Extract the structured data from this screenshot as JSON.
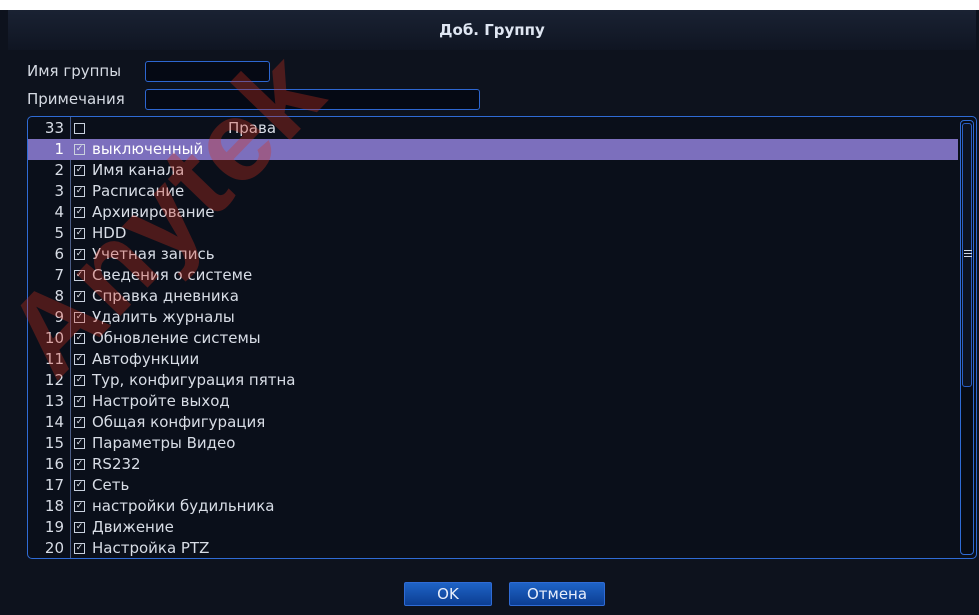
{
  "dialog": {
    "title": "Доб. Группу",
    "group_name_label": "Имя группы",
    "group_name_value": "",
    "notes_label": "Примечания",
    "notes_value": ""
  },
  "rights_list": {
    "count": "33",
    "header_label": "Права",
    "header_checked": false,
    "selected_index": 0,
    "rows": [
      {
        "num": "1",
        "label": "выключенный",
        "checked": true
      },
      {
        "num": "2",
        "label": "Имя канала",
        "checked": true
      },
      {
        "num": "3",
        "label": "Расписание",
        "checked": true
      },
      {
        "num": "4",
        "label": "Архивирование",
        "checked": true
      },
      {
        "num": "5",
        "label": "HDD",
        "checked": true
      },
      {
        "num": "6",
        "label": "Учетная запись",
        "checked": true
      },
      {
        "num": "7",
        "label": "Сведения о системе",
        "checked": true
      },
      {
        "num": "8",
        "label": "Справка дневника",
        "checked": true
      },
      {
        "num": "9",
        "label": "Удалить журналы",
        "checked": true
      },
      {
        "num": "10",
        "label": "Обновление системы",
        "checked": true
      },
      {
        "num": "11",
        "label": "Автофункции",
        "checked": true
      },
      {
        "num": "12",
        "label": "Тур, конфигурация пятна",
        "checked": true
      },
      {
        "num": "13",
        "label": "Настройте выход",
        "checked": true
      },
      {
        "num": "14",
        "label": "Общая конфигурация",
        "checked": true
      },
      {
        "num": "15",
        "label": "Параметры Видео",
        "checked": true
      },
      {
        "num": "16",
        "label": "RS232",
        "checked": true
      },
      {
        "num": "17",
        "label": "Сеть",
        "checked": true
      },
      {
        "num": "18",
        "label": "настройки будильника",
        "checked": true
      },
      {
        "num": "19",
        "label": "Движение",
        "checked": true
      },
      {
        "num": "20",
        "label": "Настройка PTZ",
        "checked": true
      }
    ]
  },
  "buttons": {
    "ok_label": "OK",
    "cancel_label": "Отмена"
  },
  "watermark": {
    "text": "Anytek"
  },
  "colors": {
    "accent_border": "#2f6bd5",
    "selected_row": "#7c6fbd",
    "background": "#0d121d",
    "button": "#1a56b8",
    "watermark": "#d8321f"
  }
}
